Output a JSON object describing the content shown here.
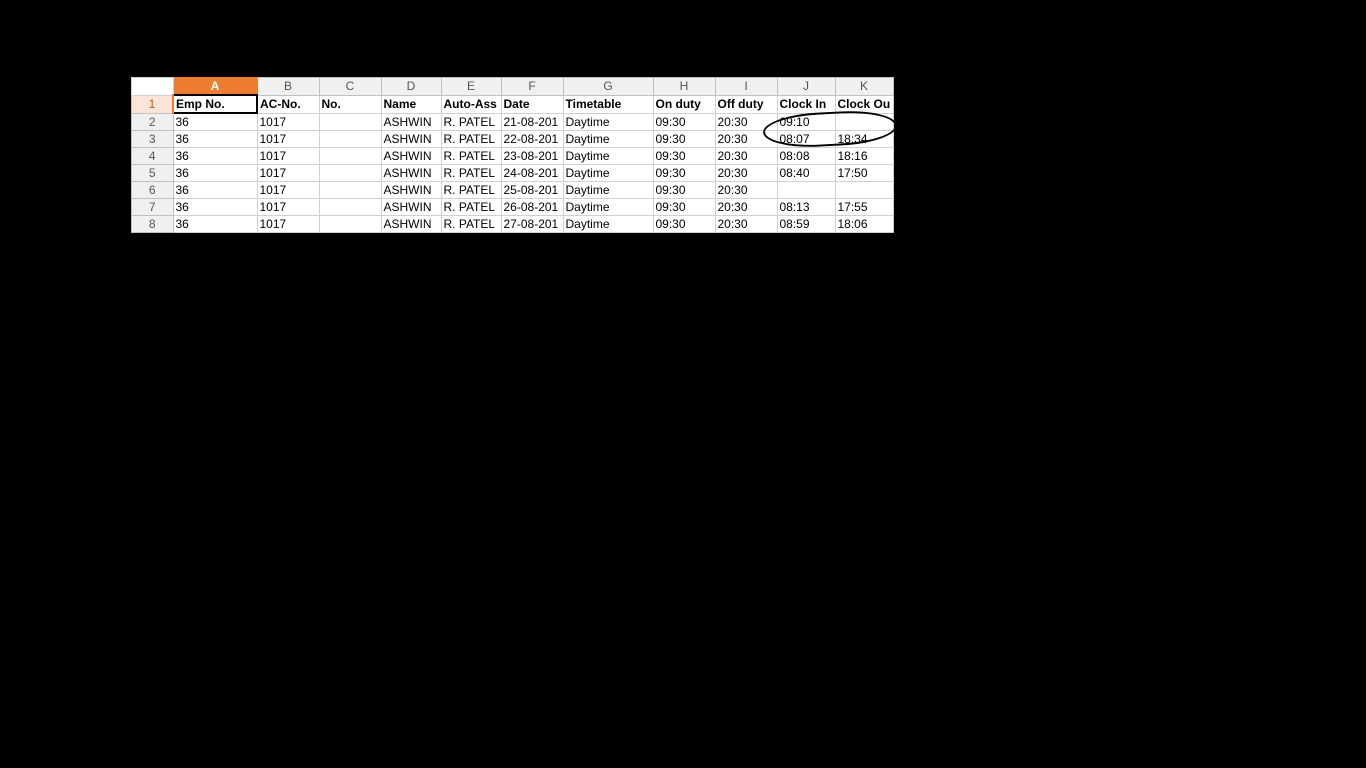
{
  "columns": [
    "A",
    "B",
    "C",
    "D",
    "E",
    "F",
    "G",
    "H",
    "I",
    "J",
    "K"
  ],
  "row_numbers": [
    "1",
    "2",
    "3",
    "4",
    "5",
    "6",
    "7",
    "8"
  ],
  "headers": {
    "A": "Emp No.",
    "B": "AC-No.",
    "C": "No.",
    "D": "Name",
    "E": "Auto-Ass",
    "F": "Date",
    "G": "Timetable",
    "H": "On duty",
    "I": "Off duty",
    "J": "Clock In",
    "K": "Clock Ou"
  },
  "rows": [
    {
      "A": "36",
      "B": "1017",
      "C": "",
      "D": "ASHWIN",
      "E": "R. PATEL",
      "F": "21-08-201",
      "G": "Daytime",
      "H": "09:30",
      "I": "20:30",
      "J": "09:10",
      "K": ""
    },
    {
      "A": "36",
      "B": "1017",
      "C": "",
      "D": "ASHWIN",
      "E": "R. PATEL",
      "F": "22-08-201",
      "G": "Daytime",
      "H": "09:30",
      "I": "20:30",
      "J": "08:07",
      "K": "18:34"
    },
    {
      "A": "36",
      "B": "1017",
      "C": "",
      "D": "ASHWIN",
      "E": "R. PATEL",
      "F": "23-08-201",
      "G": "Daytime",
      "H": "09:30",
      "I": "20:30",
      "J": "08:08",
      "K": "18:16"
    },
    {
      "A": "36",
      "B": "1017",
      "C": "",
      "D": "ASHWIN",
      "E": "R. PATEL",
      "F": "24-08-201",
      "G": "Daytime",
      "H": "09:30",
      "I": "20:30",
      "J": "08:40",
      "K": "17:50"
    },
    {
      "A": "36",
      "B": "1017",
      "C": "",
      "D": "ASHWIN",
      "E": "R. PATEL",
      "F": "25-08-201",
      "G": "Daytime",
      "H": "09:30",
      "I": "20:30",
      "J": "",
      "K": ""
    },
    {
      "A": "36",
      "B": "1017",
      "C": "",
      "D": "ASHWIN",
      "E": "R. PATEL",
      "F": "26-08-201",
      "G": "Daytime",
      "H": "09:30",
      "I": "20:30",
      "J": "08:13",
      "K": "17:55"
    },
    {
      "A": "36",
      "B": "1017",
      "C": "",
      "D": "ASHWIN",
      "E": "R. PATEL",
      "F": "27-08-201",
      "G": "Daytime",
      "H": "09:30",
      "I": "20:30",
      "J": "08:59",
      "K": "18:06"
    }
  ],
  "selected_column": "A",
  "selected_cell": "A1"
}
